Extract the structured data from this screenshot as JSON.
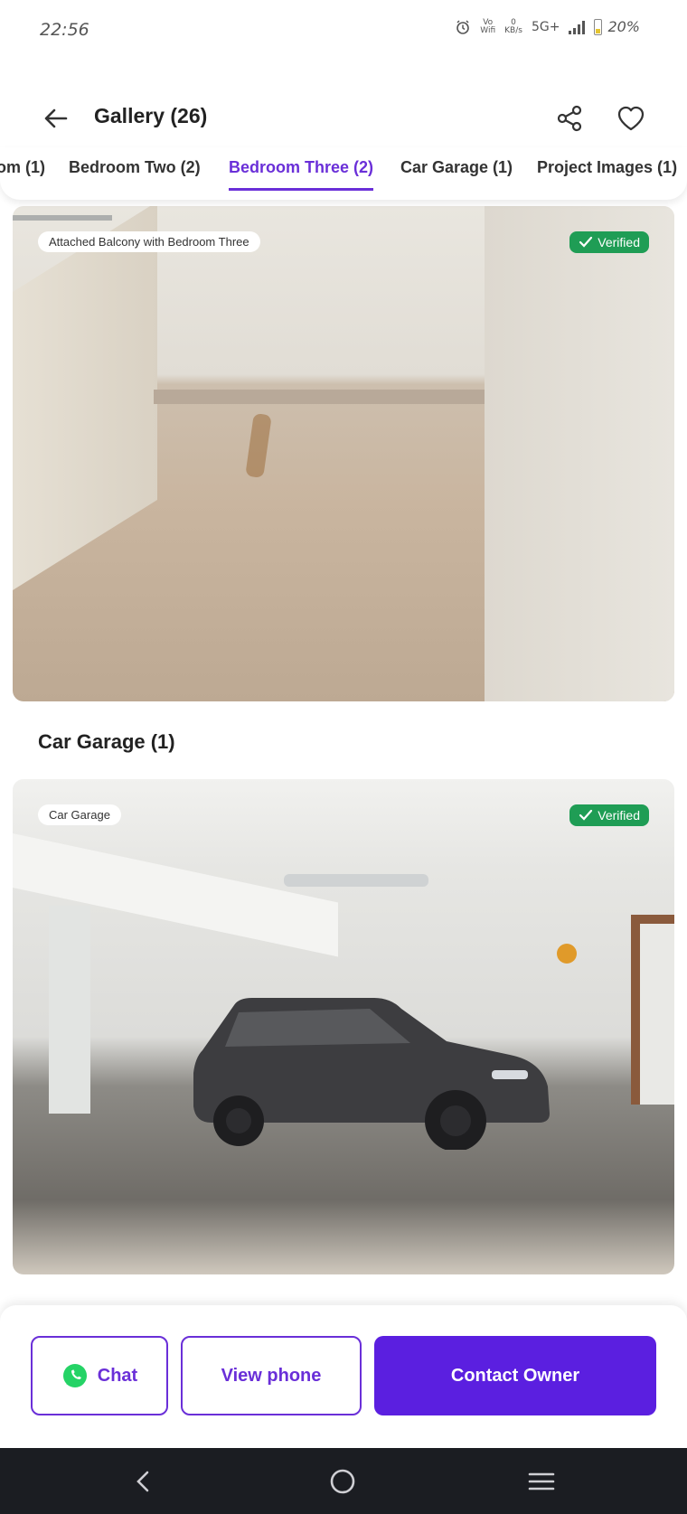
{
  "status_bar": {
    "time": "22:56",
    "net_speed_top": "0",
    "net_speed_bottom": "KB/s",
    "vo_top": "Vo",
    "vo_bottom": "Wifi",
    "network": "5G+",
    "battery": "20%"
  },
  "header": {
    "title": "Gallery (26)"
  },
  "tabs": [
    {
      "label": "om (1)",
      "active": false
    },
    {
      "label": "Bedroom Two (2)",
      "active": false
    },
    {
      "label": "Bedroom Three (2)",
      "active": true
    },
    {
      "label": "Car Garage (1)",
      "active": false
    },
    {
      "label": "Project Images (1)",
      "active": false
    }
  ],
  "photos": [
    {
      "tag": "Attached Balcony with Bedroom Three",
      "verified": "Verified"
    },
    {
      "tag": "Car Garage",
      "verified": "Verified"
    }
  ],
  "sections": {
    "car_garage_title": "Car Garage (1)"
  },
  "actions": {
    "chat": "Chat",
    "view_phone": "View phone",
    "contact_owner": "Contact Owner"
  },
  "colors": {
    "accent": "#6a2fd8",
    "primary_button": "#5b1fe0",
    "verified": "#1f9d55",
    "whatsapp": "#25d366"
  },
  "icons": {
    "back": "arrow-left-icon",
    "share": "share-icon",
    "favorite": "heart-icon",
    "chat": "whatsapp-icon",
    "verified": "check-icon",
    "nav_back": "chevron-left-icon",
    "nav_home": "circle-home-icon",
    "nav_recents": "menu-lines-icon"
  }
}
